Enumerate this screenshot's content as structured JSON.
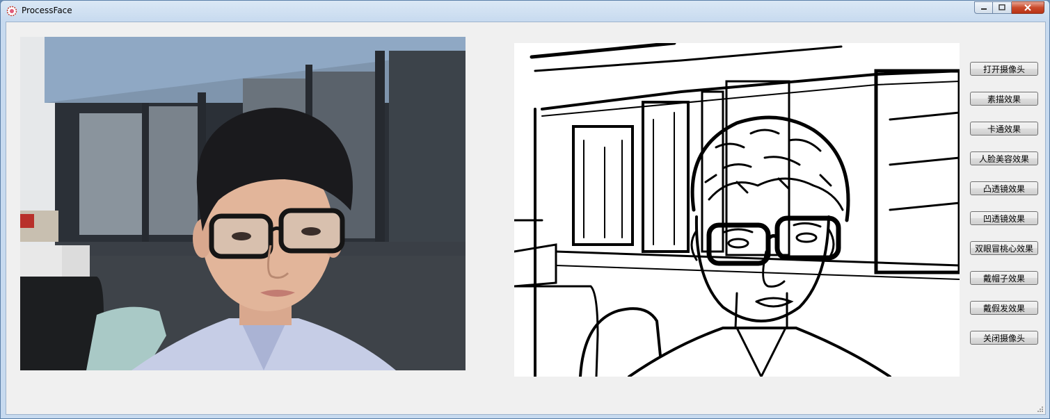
{
  "window": {
    "title": "ProcessFace",
    "icon": "app-flower-icon",
    "controls": [
      "minimize-icon",
      "maximize-icon",
      "close-icon"
    ]
  },
  "camera_view": {
    "icon": "webcam-photo"
  },
  "effect_view": {
    "icon": "sketch-effect-photo"
  },
  "buttons": [
    {
      "id": "open-camera",
      "label": "打开摄像头"
    },
    {
      "id": "sketch",
      "label": "素描效果"
    },
    {
      "id": "cartoon",
      "label": "卡通效果"
    },
    {
      "id": "beauty",
      "label": "人脸美容效果"
    },
    {
      "id": "convex-lens",
      "label": "凸透镜效果"
    },
    {
      "id": "concave-lens",
      "label": "凹透镜效果"
    },
    {
      "id": "heart-eyes",
      "label": "双眼冒桃心效果"
    },
    {
      "id": "hat",
      "label": "戴帽子效果"
    },
    {
      "id": "wig",
      "label": "戴假发效果"
    },
    {
      "id": "close-camera",
      "label": "关闭摄像头"
    }
  ],
  "colors": {
    "title_bar": "#c7daef",
    "client_bg": "#f0f0f0",
    "close_button": "#c94a2c"
  }
}
